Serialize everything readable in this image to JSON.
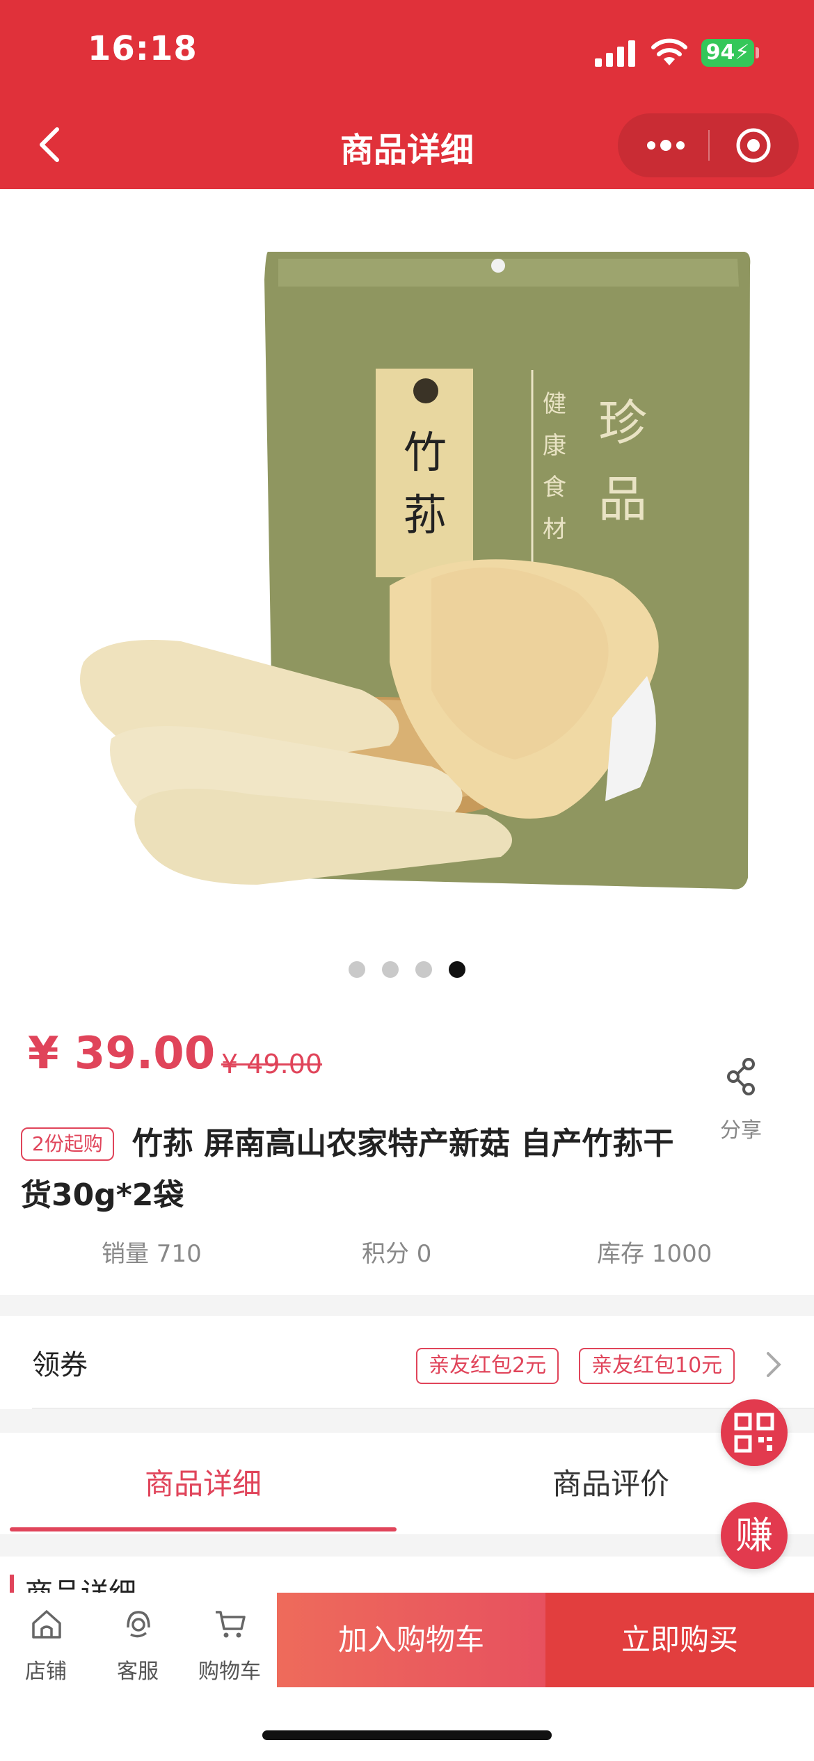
{
  "status_bar": {
    "time": "16:18",
    "battery": "94"
  },
  "nav": {
    "title": "商品详细"
  },
  "gallery": {
    "package_label": "竹荪",
    "package_side_text": "健康食材",
    "package_brand": "珍品",
    "dots_total": 4,
    "dots_active": 4
  },
  "product": {
    "price": "¥ 39.00",
    "original_price": "¥ 49.00",
    "share_label": "分享",
    "min_badge": "2份起购",
    "title": "竹荪 屏南高山农家特产新菇 自产竹荪干货30g*2袋",
    "stats": {
      "sales": "销量 710",
      "points": "积分 0",
      "stock": "库存 1000"
    }
  },
  "coupon": {
    "label": "领券",
    "tags": [
      "亲友红包2元",
      "亲友红包10元"
    ]
  },
  "tabs": {
    "detail": "商品详细",
    "review": "商品评价"
  },
  "section": {
    "title": "商品详细"
  },
  "float": {
    "earn": "赚"
  },
  "bottom_bar": {
    "shop": "店铺",
    "service": "客服",
    "cart": "购物车",
    "add_to_cart": "加入购物车",
    "buy_now": "立即购买"
  },
  "colors": {
    "brand_red": "#e0313a",
    "accent_pink": "#e0445a"
  }
}
